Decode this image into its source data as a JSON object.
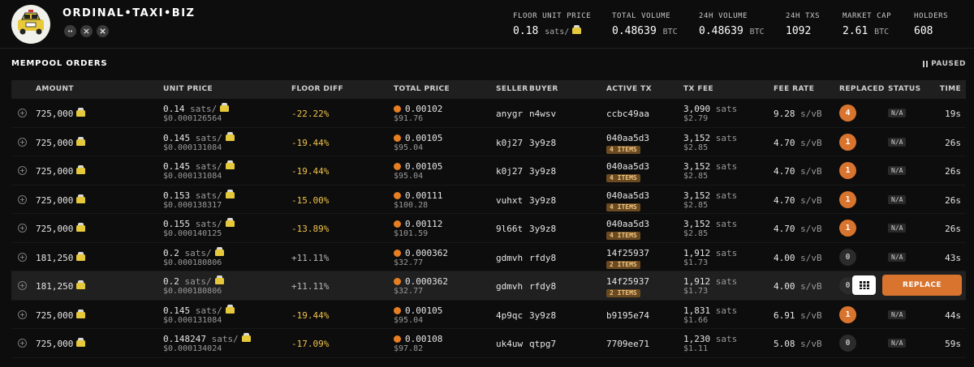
{
  "collection": {
    "title": "ORDINAL•TAXI•BIZ",
    "social_icons": [
      "discord-icon",
      "website-icon",
      "x-icon"
    ]
  },
  "stats": [
    {
      "label": "FLOOR UNIT PRICE",
      "value": "0.18",
      "unit": "sats/"
    },
    {
      "label": "TOTAL VOLUME",
      "value": "0.48639",
      "unit": "BTC"
    },
    {
      "label": "24H VOLUME",
      "value": "0.48639",
      "unit": "BTC"
    },
    {
      "label": "24H TXS",
      "value": "1092",
      "unit": ""
    },
    {
      "label": "MARKET CAP",
      "value": "2.61",
      "unit": "BTC"
    },
    {
      "label": "HOLDERS",
      "value": "608",
      "unit": ""
    }
  ],
  "section": {
    "title": "MEMPOOL ORDERS",
    "paused_label": "PAUSED"
  },
  "columns": [
    "AMOUNT",
    "UNIT PRICE",
    "FLOOR DIFF",
    "TOTAL PRICE",
    "SELLER",
    "BUYER",
    "ACTIVE TX",
    "TX FEE",
    "FEE RATE",
    "REPLACED",
    "STATUS",
    "TIME"
  ],
  "replace_label": "REPLACE",
  "rows": [
    {
      "amount": "725,000",
      "unit_price": "0.14",
      "unit_usd": "$0.000126564",
      "floor_diff": "-22.22%",
      "total_btc": "0.00102",
      "total_usd": "$91.76",
      "seller": "anygr",
      "buyer": "n4wsv",
      "tx": "ccbc49aa",
      "items": "",
      "fee_sats": "3,090",
      "fee_usd": "$2.79",
      "fee_rate": "9.28",
      "replaced": "4",
      "status": "N/A",
      "time": "19s"
    },
    {
      "amount": "725,000",
      "unit_price": "0.145",
      "unit_usd": "$0.000131084",
      "floor_diff": "-19.44%",
      "total_btc": "0.00105",
      "total_usd": "$95.04",
      "seller": "k0j27",
      "buyer": "3y9z8",
      "tx": "040aa5d3",
      "items": "4 ITEMS",
      "fee_sats": "3,152",
      "fee_usd": "$2.85",
      "fee_rate": "4.70",
      "replaced": "1",
      "status": "N/A",
      "time": "26s"
    },
    {
      "amount": "725,000",
      "unit_price": "0.145",
      "unit_usd": "$0.000131084",
      "floor_diff": "-19.44%",
      "total_btc": "0.00105",
      "total_usd": "$95.04",
      "seller": "k0j27",
      "buyer": "3y9z8",
      "tx": "040aa5d3",
      "items": "4 ITEMS",
      "fee_sats": "3,152",
      "fee_usd": "$2.85",
      "fee_rate": "4.70",
      "replaced": "1",
      "status": "N/A",
      "time": "26s"
    },
    {
      "amount": "725,000",
      "unit_price": "0.153",
      "unit_usd": "$0.000138317",
      "floor_diff": "-15.00%",
      "total_btc": "0.00111",
      "total_usd": "$100.28",
      "seller": "vuhxt",
      "buyer": "3y9z8",
      "tx": "040aa5d3",
      "items": "4 ITEMS",
      "fee_sats": "3,152",
      "fee_usd": "$2.85",
      "fee_rate": "4.70",
      "replaced": "1",
      "status": "N/A",
      "time": "26s"
    },
    {
      "amount": "725,000",
      "unit_price": "0.155",
      "unit_usd": "$0.000140125",
      "floor_diff": "-13.89%",
      "total_btc": "0.00112",
      "total_usd": "$101.59",
      "seller": "9l66t",
      "buyer": "3y9z8",
      "tx": "040aa5d3",
      "items": "4 ITEMS",
      "fee_sats": "3,152",
      "fee_usd": "$2.85",
      "fee_rate": "4.70",
      "replaced": "1",
      "status": "N/A",
      "time": "26s"
    },
    {
      "amount": "181,250",
      "unit_price": "0.2",
      "unit_usd": "$0.000180806",
      "floor_diff": "+11.11%",
      "total_btc": "0.000362",
      "total_usd": "$32.77",
      "seller": "gdmvh",
      "buyer": "rfdy8",
      "tx": "14f25937",
      "items": "2 ITEMS",
      "fee_sats": "1,912",
      "fee_usd": "$1.73",
      "fee_rate": "4.00",
      "replaced": "0",
      "status": "N/A",
      "time": "43s"
    },
    {
      "amount": "181,250",
      "unit_price": "0.2",
      "unit_usd": "$0.000180806",
      "floor_diff": "+11.11%",
      "total_btc": "0.000362",
      "total_usd": "$32.77",
      "seller": "gdmvh",
      "buyer": "rfdy8",
      "tx": "14f25937",
      "items": "2 ITEMS",
      "fee_sats": "1,912",
      "fee_usd": "$1.73",
      "fee_rate": "4.00",
      "replaced": "0",
      "status": "",
      "time": ""
    },
    {
      "amount": "725,000",
      "unit_price": "0.145",
      "unit_usd": "$0.000131084",
      "floor_diff": "-19.44%",
      "total_btc": "0.00105",
      "total_usd": "$95.04",
      "seller": "4p9qc",
      "buyer": "3y9z8",
      "tx": "b9195e74",
      "items": "",
      "fee_sats": "1,831",
      "fee_usd": "$1.66",
      "fee_rate": "6.91",
      "replaced": "1",
      "status": "N/A",
      "time": "44s"
    },
    {
      "amount": "725,000",
      "unit_price": "0.148247",
      "unit_usd": "$0.000134024",
      "floor_diff": "-17.09%",
      "total_btc": "0.00108",
      "total_usd": "$97.82",
      "seller": "uk4uw",
      "buyer": "qtpg7",
      "tx": "7709ee71",
      "items": "",
      "fee_sats": "1,230",
      "fee_usd": "$1.11",
      "fee_rate": "5.08",
      "replaced": "0",
      "status": "N/A",
      "time": "59s"
    }
  ],
  "units": {
    "sats": "sats",
    "sats_per": "sats/",
    "svb": "s/vB"
  },
  "colors": {
    "accent": "#d9742f",
    "negative": "#f0c24b",
    "background": "#0d0d0d"
  }
}
